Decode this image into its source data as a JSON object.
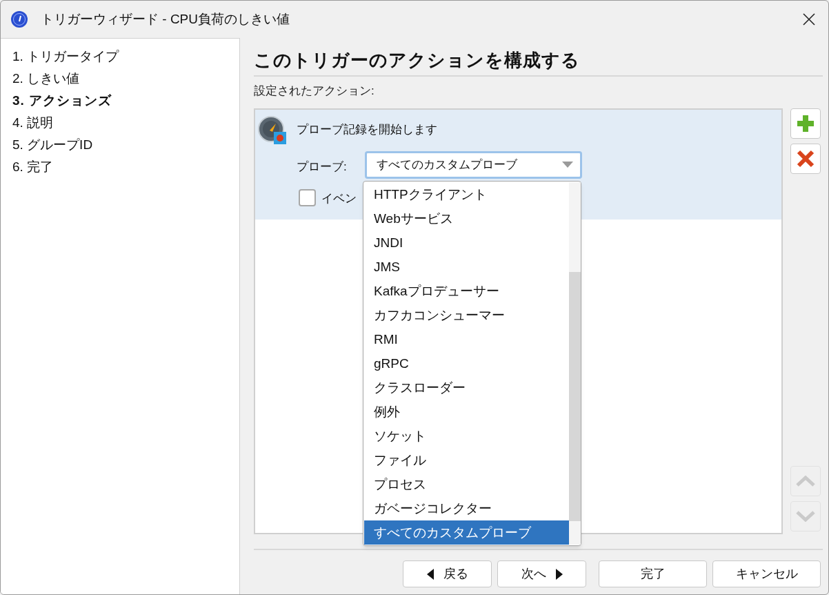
{
  "window": {
    "title": "トリガーウィザード - CPU負荷のしきい値"
  },
  "steps": [
    {
      "label": "1. トリガータイプ",
      "selected": false
    },
    {
      "label": "2. しきい値",
      "selected": false
    },
    {
      "label": "3. アクションズ",
      "selected": true
    },
    {
      "label": "4. 説明",
      "selected": false
    },
    {
      "label": "5. グループID",
      "selected": false
    },
    {
      "label": "6. 完了",
      "selected": false
    }
  ],
  "heading": "このトリガーのアクションを構成する",
  "actions_label": "設定されたアクション:",
  "actions": [
    {
      "title": "プローブ記録を開始します",
      "selected": true,
      "probe_label": "プローブ:",
      "probe_value": "すべてのカスタムプローブ",
      "option": {
        "label": "イベン",
        "checked": false
      }
    }
  ],
  "dropdown": {
    "expanded": true,
    "items": [
      {
        "label": "HTTPクライアント",
        "selected": false
      },
      {
        "label": "Webサービス",
        "selected": false
      },
      {
        "label": "JNDI",
        "selected": false
      },
      {
        "label": "JMS",
        "selected": false
      },
      {
        "label": "Kafkaプロデューサー",
        "selected": false
      },
      {
        "label": "カフカコンシューマー",
        "selected": false
      },
      {
        "label": "RMI",
        "selected": false
      },
      {
        "label": "gRPC",
        "selected": false
      },
      {
        "label": "クラスローダー",
        "selected": false
      },
      {
        "label": "例外",
        "selected": false
      },
      {
        "label": "ソケット",
        "selected": false
      },
      {
        "label": "ファイル",
        "selected": false
      },
      {
        "label": "プロセス",
        "selected": false
      },
      {
        "label": "ガベージコレクター",
        "selected": false
      },
      {
        "label": "すべてのカスタムプローブ",
        "selected": true
      }
    ]
  },
  "side_buttons": [
    {
      "kind": "add",
      "disabled": false
    },
    {
      "kind": "remove",
      "disabled": false
    },
    {
      "kind": "up",
      "disabled": true
    },
    {
      "kind": "down",
      "disabled": true
    }
  ],
  "buttons": [
    {
      "kind": "back",
      "label": "戻る"
    },
    {
      "kind": "next",
      "label": "次へ"
    },
    {
      "kind": "plain",
      "label": "完了"
    },
    {
      "kind": "plain",
      "label": "キャンセル"
    }
  ]
}
